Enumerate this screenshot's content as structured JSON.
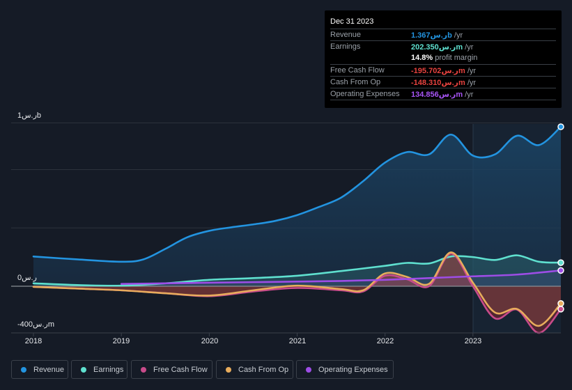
{
  "tooltip": {
    "date": "Dec 31 2023",
    "rows": [
      {
        "label": "Revenue",
        "value": "1.367ر.سb",
        "unit": " /yr",
        "color": "#2394e0"
      },
      {
        "label": "Earnings",
        "value": "202.350ر.سm",
        "unit": " /yr",
        "color": "#5fe0cf"
      },
      {
        "label": "",
        "value": "14.8%",
        "unit": " profit margin",
        "color": "#ffffff"
      },
      {
        "label": "Free Cash Flow",
        "value": "-195.702ر.سm",
        "unit": " /yr",
        "color": "#e8433f"
      },
      {
        "label": "Cash From Op",
        "value": "-148.310ر.سm",
        "unit": " /yr",
        "color": "#e8433f"
      },
      {
        "label": "Operating Expenses",
        "value": "134.856ر.سm",
        "unit": " /yr",
        "color": "#a855f7"
      }
    ]
  },
  "legend": [
    {
      "label": "Revenue",
      "color": "#2394e0"
    },
    {
      "label": "Earnings",
      "color": "#5fe0cf"
    },
    {
      "label": "Free Cash Flow",
      "color": "#c84b8a"
    },
    {
      "label": "Cash From Op",
      "color": "#e8ac5c"
    },
    {
      "label": "Operating Expenses",
      "color": "#9d4de6"
    }
  ],
  "chart_data": {
    "type": "area",
    "title": "",
    "xlabel": "",
    "ylabel": "",
    "y_tick_labels": [
      "1ر.سb",
      "0ر.س",
      "-400ر.سm"
    ],
    "x_tick_labels": [
      "2018",
      "2019",
      "2020",
      "2021",
      "2022",
      "2023"
    ],
    "ylim_millions": [
      -400,
      1400
    ],
    "xlim": [
      2018.0,
      2024.0
    ],
    "grid": true,
    "legend_position": "bottom",
    "forecast_shaded_from": 2023.0,
    "series": [
      {
        "name": "Revenue",
        "color": "#2394e0",
        "x": [
          2018.0,
          2018.5,
          2019.0,
          2019.25,
          2019.5,
          2019.75,
          2020.0,
          2020.25,
          2020.5,
          2020.75,
          2021.0,
          2021.25,
          2021.5,
          2021.75,
          2022.0,
          2022.25,
          2022.5,
          2022.75,
          2023.0,
          2023.25,
          2023.5,
          2023.75,
          2024.0
        ],
        "values": [
          255,
          230,
          210,
          230,
          320,
          420,
          475,
          505,
          530,
          560,
          610,
          680,
          760,
          900,
          1060,
          1150,
          1130,
          1300,
          1120,
          1130,
          1290,
          1210,
          1367
        ]
      },
      {
        "name": "Earnings",
        "color": "#5fe0cf",
        "x": [
          2018.0,
          2018.5,
          2019.0,
          2019.5,
          2020.0,
          2020.5,
          2021.0,
          2021.5,
          2022.0,
          2022.25,
          2022.5,
          2022.75,
          2023.0,
          2023.25,
          2023.5,
          2023.75,
          2024.0
        ],
        "values": [
          25,
          10,
          5,
          25,
          55,
          70,
          90,
          130,
          175,
          200,
          195,
          255,
          250,
          225,
          265,
          210,
          202
        ]
      },
      {
        "name": "Free Cash Flow",
        "color": "#c84b8a",
        "x": [
          2018.0,
          2018.5,
          2019.0,
          2019.5,
          2020.0,
          2020.5,
          2021.0,
          2021.5,
          2021.75,
          2022.0,
          2022.25,
          2022.5,
          2022.75,
          2023.0,
          2023.25,
          2023.5,
          2023.75,
          2024.0
        ],
        "values": [
          -5,
          -20,
          -35,
          -60,
          -85,
          -45,
          -15,
          -35,
          -45,
          90,
          60,
          0,
          280,
          0,
          -275,
          -200,
          -400,
          -196
        ]
      },
      {
        "name": "Cash From Op",
        "color": "#e8ac5c",
        "x": [
          2018.0,
          2018.5,
          2019.0,
          2019.5,
          2020.0,
          2020.5,
          2021.0,
          2021.5,
          2021.75,
          2022.0,
          2022.25,
          2022.5,
          2022.75,
          2023.0,
          2023.25,
          2023.5,
          2023.75,
          2024.0
        ],
        "values": [
          -5,
          -20,
          -35,
          -60,
          -80,
          -35,
          5,
          -25,
          -35,
          110,
          80,
          20,
          290,
          30,
          -225,
          -195,
          -340,
          -148
        ]
      },
      {
        "name": "Operating Expenses",
        "color": "#9d4de6",
        "x": [
          2019.0,
          2019.5,
          2020.0,
          2020.5,
          2021.0,
          2021.5,
          2022.0,
          2022.5,
          2023.0,
          2023.5,
          2024.0
        ],
        "values": [
          20,
          25,
          30,
          35,
          40,
          45,
          55,
          70,
          85,
          100,
          135
        ]
      }
    ]
  }
}
